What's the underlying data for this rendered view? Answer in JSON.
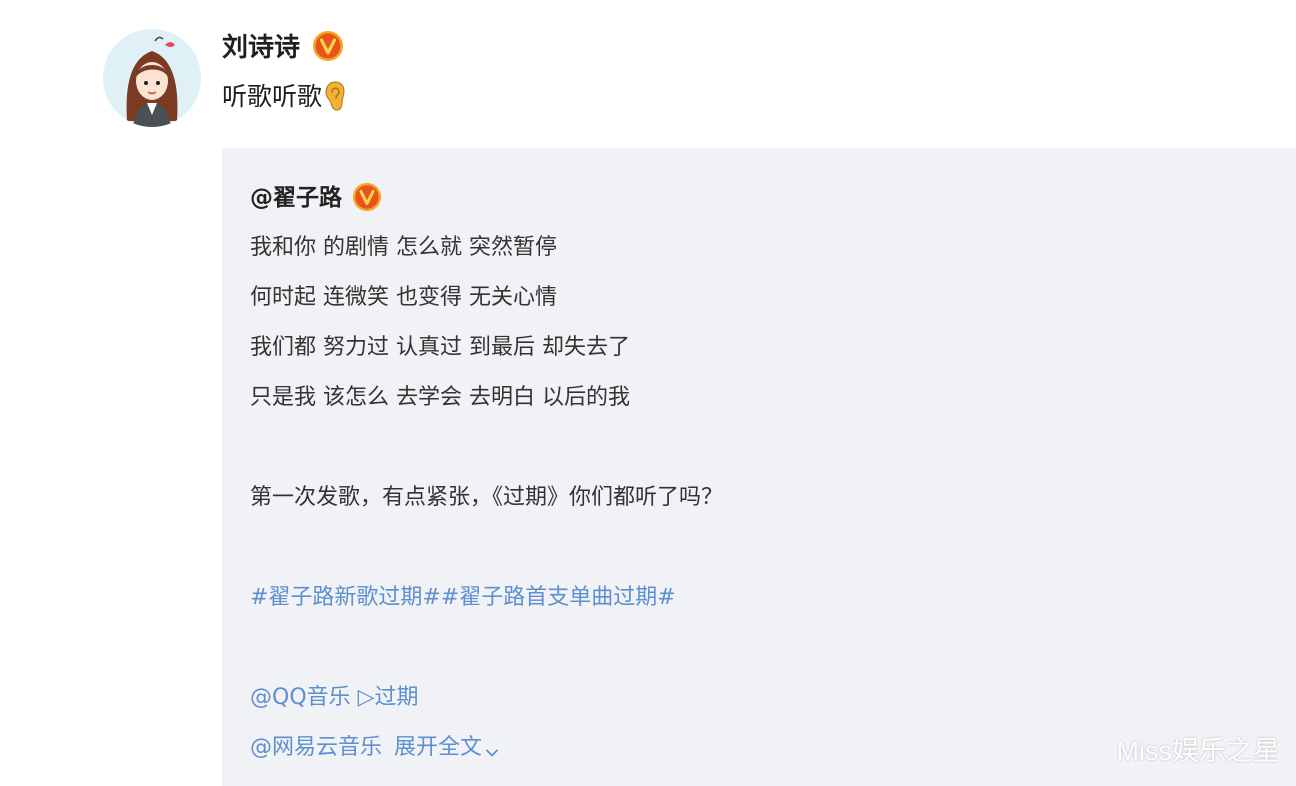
{
  "post": {
    "author": "刘诗诗",
    "text": "听歌听歌",
    "emoji_icon": "ear-icon"
  },
  "repost": {
    "author": "@翟子路",
    "lyrics": [
      "我和你 的剧情 怎么就 突然暂停",
      "何时起 连微笑 也变得 无关心情",
      "我们都 努力过 认真过 到最后 却失去了",
      "只是我 该怎么 去学会 去明白 以后的我"
    ],
    "message": "第一次发歌，有点紧张，《过期》你们都听了吗？",
    "topics": "#翟子路新歌过期##翟子路首支单曲过期#",
    "qq_line": "@QQ音乐 ▷过期",
    "netease_mention": "@网易云音乐",
    "expand_label": "展开全文"
  },
  "watermark": "Miss娱乐之星",
  "colors": {
    "link": "#5d8fd1",
    "repost_bg": "#f1f2f5",
    "verified_badge": "#f07a1b"
  }
}
